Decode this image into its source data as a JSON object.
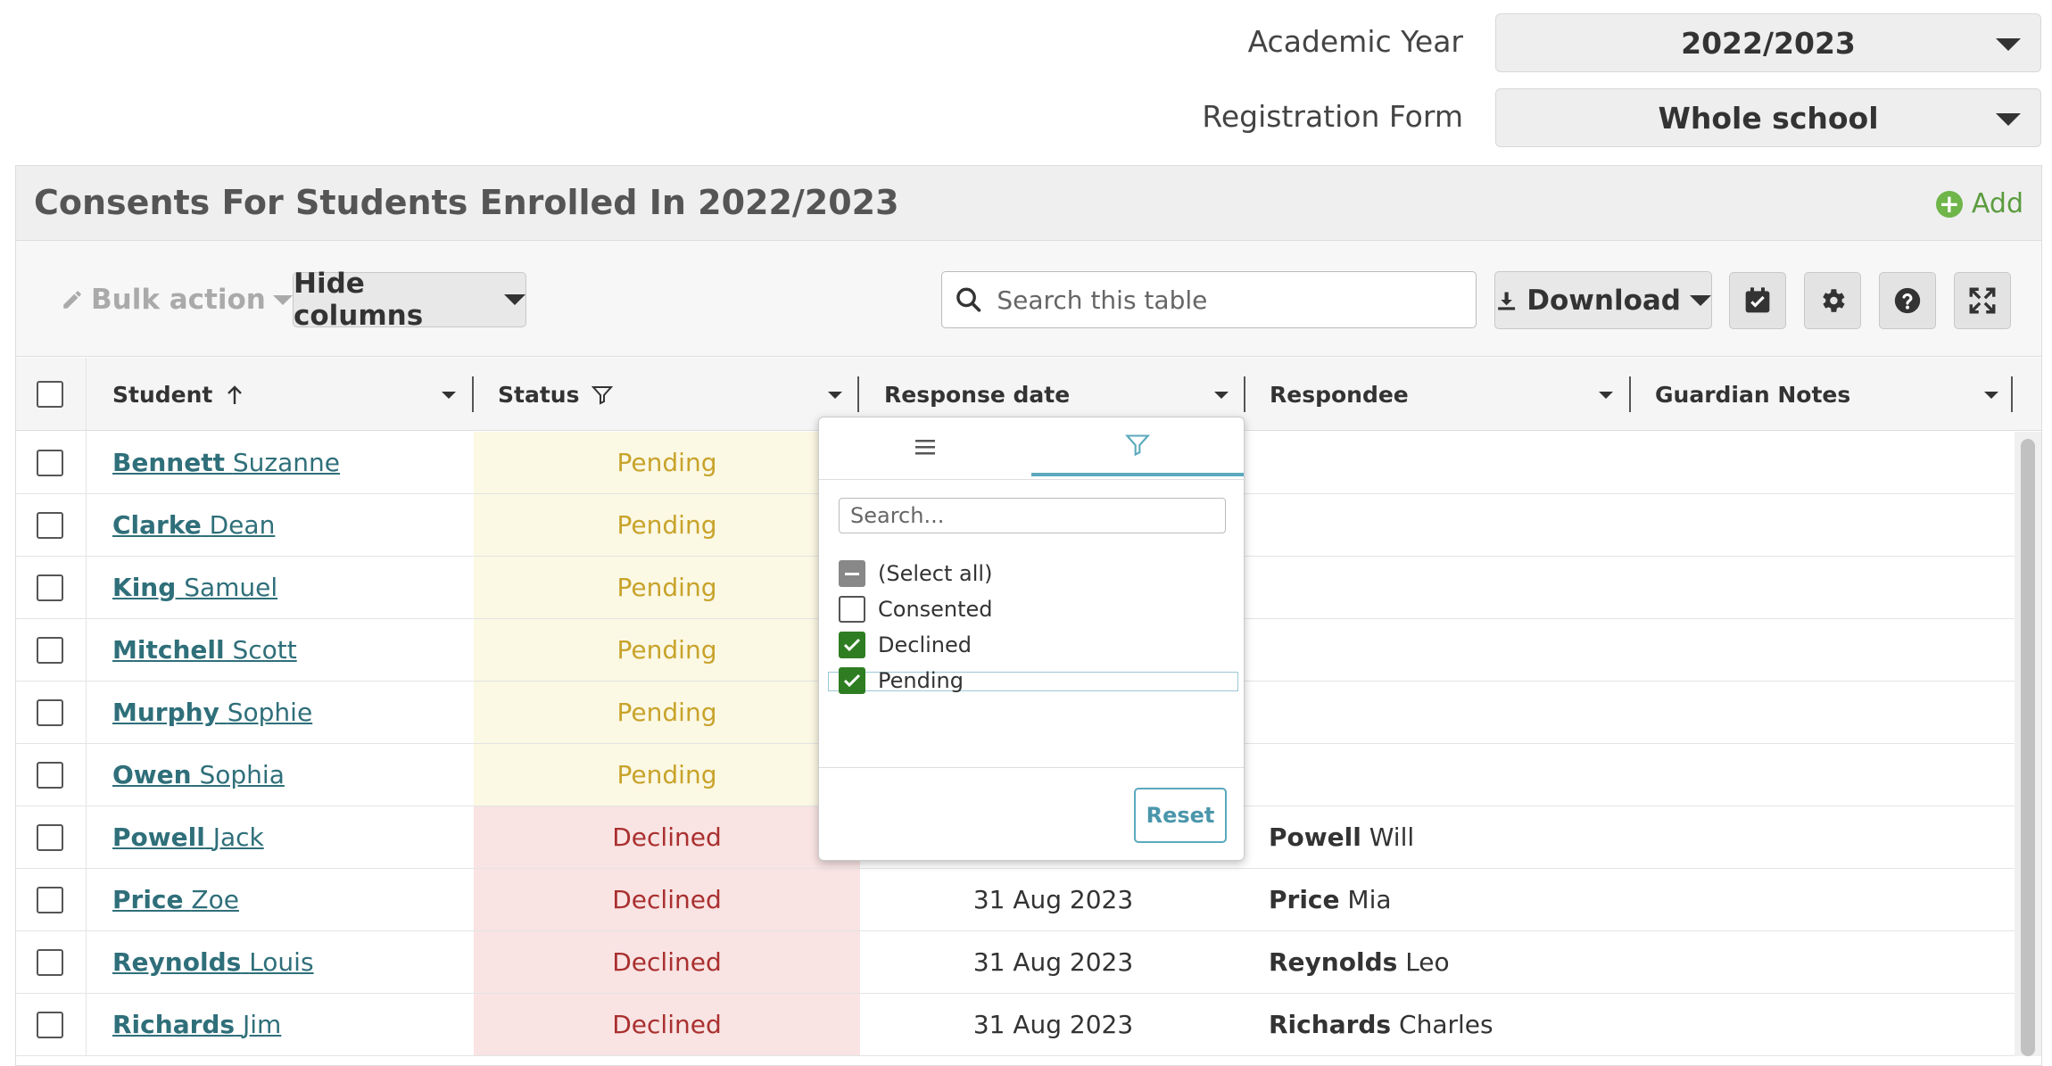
{
  "filters": {
    "academic_year_label": "Academic Year",
    "academic_year_value": "2022/2023",
    "registration_form_label": "Registration Form",
    "registration_form_value": "Whole school"
  },
  "panel": {
    "title": "Consents For Students Enrolled In 2022/2023",
    "add_label": "Add"
  },
  "toolbar": {
    "bulk_action_label": "Bulk action",
    "hide_columns_label": "Hide columns",
    "search_placeholder": "Search this table",
    "download_label": "Download"
  },
  "table": {
    "columns": [
      "Student",
      "Status",
      "Response date",
      "Respondee",
      "Guardian Notes"
    ],
    "rows": [
      {
        "last": "Bennett",
        "first": "Suzanne",
        "status": "Pending",
        "date": "",
        "resp_last": "",
        "resp_first": ""
      },
      {
        "last": "Clarke",
        "first": "Dean",
        "status": "Pending",
        "date": "",
        "resp_last": "",
        "resp_first": ""
      },
      {
        "last": "King",
        "first": "Samuel",
        "status": "Pending",
        "date": "",
        "resp_last": "",
        "resp_first": ""
      },
      {
        "last": "Mitchell",
        "first": "Scott",
        "status": "Pending",
        "date": "",
        "resp_last": "",
        "resp_first": ""
      },
      {
        "last": "Murphy",
        "first": "Sophie",
        "status": "Pending",
        "date": "",
        "resp_last": "",
        "resp_first": ""
      },
      {
        "last": "Owen",
        "first": "Sophia",
        "status": "Pending",
        "date": "",
        "resp_last": "",
        "resp_first": ""
      },
      {
        "last": "Powell",
        "first": "Jack",
        "status": "Declined",
        "date": "",
        "resp_last": "Powell",
        "resp_first": "Will"
      },
      {
        "last": "Price",
        "first": "Zoe",
        "status": "Declined",
        "date": "31 Aug 2023",
        "resp_last": "Price",
        "resp_first": "Mia"
      },
      {
        "last": "Reynolds",
        "first": "Louis",
        "status": "Declined",
        "date": "31 Aug 2023",
        "resp_last": "Reynolds",
        "resp_first": "Leo"
      },
      {
        "last": "Richards",
        "first": "Jim",
        "status": "Declined",
        "date": "31 Aug 2023",
        "resp_last": "Richards",
        "resp_first": "Charles"
      }
    ]
  },
  "filter_popup": {
    "search_placeholder": "Search...",
    "options": [
      {
        "label": "(Select all)",
        "state": "indeterminate"
      },
      {
        "label": "Consented",
        "state": "unchecked"
      },
      {
        "label": "Declined",
        "state": "checked"
      },
      {
        "label": "Pending",
        "state": "checked"
      }
    ],
    "reset_label": "Reset"
  },
  "colors": {
    "pending_bg": "#fbf8e3",
    "pending_text": "#c8a32b",
    "declined_bg": "#f9e3e3",
    "declined_text": "#a9302f",
    "link": "#2f6f7a",
    "accent": "#5aa9bd",
    "check_green": "#2f7d22"
  }
}
